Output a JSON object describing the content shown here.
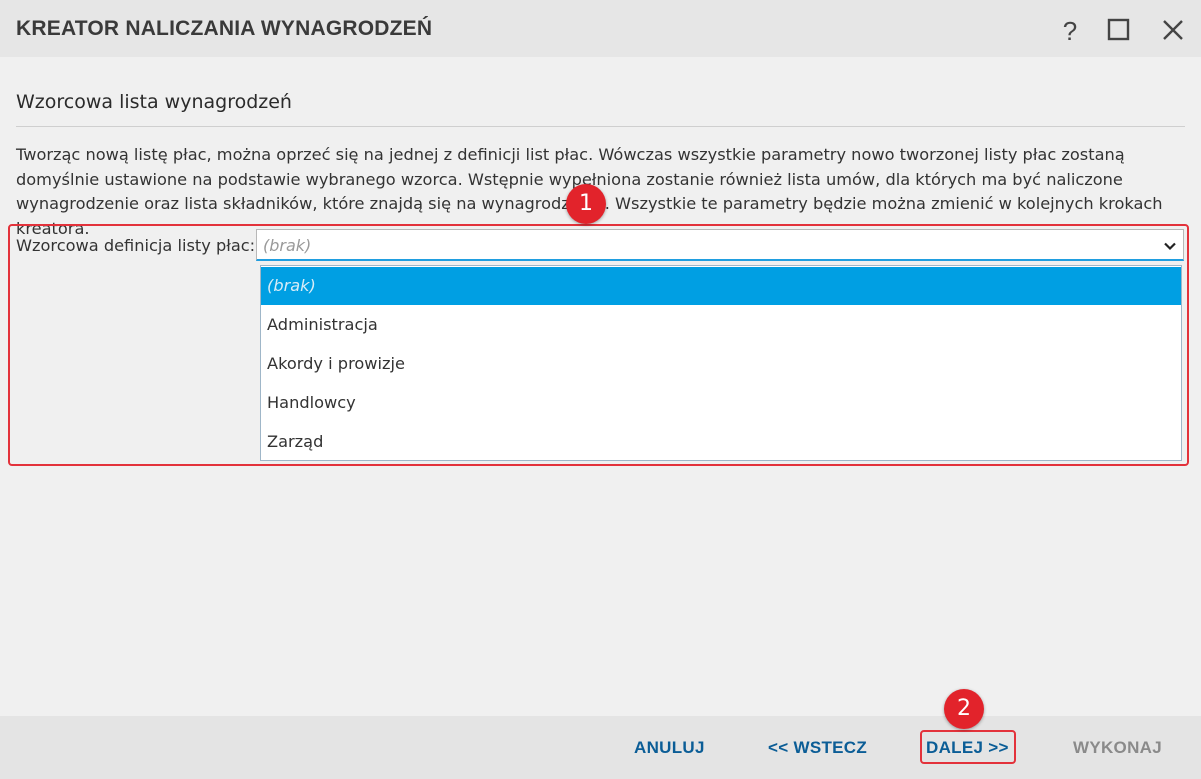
{
  "window": {
    "title": "KREATOR NALICZANIA WYNAGRODZEŃ",
    "help_label": "?",
    "icons": [
      "help-icon",
      "maximize-icon",
      "close-icon"
    ]
  },
  "section": {
    "title": "Wzorcowa lista wynagrodzeń",
    "description": "Tworząc nową listę płac, można oprzeć się na jednej z definicji list płac. Wówczas wszystkie parametry nowo tworzonej listy płac zostaną domyślnie ustawione na podstawie wybranego wzorca. Wstępnie wypełniona zostanie również lista umów, dla których ma być naliczone wynagrodzenie oraz lista składników, które znajdą się na wynagrodzeniu. Wszystkie te parametry będzie można zmienić w kolejnych krokach kreatora."
  },
  "field": {
    "label": "Wzorcowa definicja listy płac:",
    "value": "(brak)",
    "options": [
      "(brak)",
      "Administracja",
      "Akordy i prowizje",
      "Handlowcy",
      "Zarząd"
    ],
    "selected_index": 0
  },
  "annotations": {
    "badge1": "1",
    "badge2": "2",
    "color": "#e2232b"
  },
  "footer": {
    "cancel": "ANULUJ",
    "back": "<< WSTECZ",
    "next": "DALEJ >>",
    "finish": "WYKONAJ"
  },
  "colors": {
    "accent": "#009fe3",
    "button_text": "#0b5d96",
    "disabled_text": "#8a8a8a"
  }
}
